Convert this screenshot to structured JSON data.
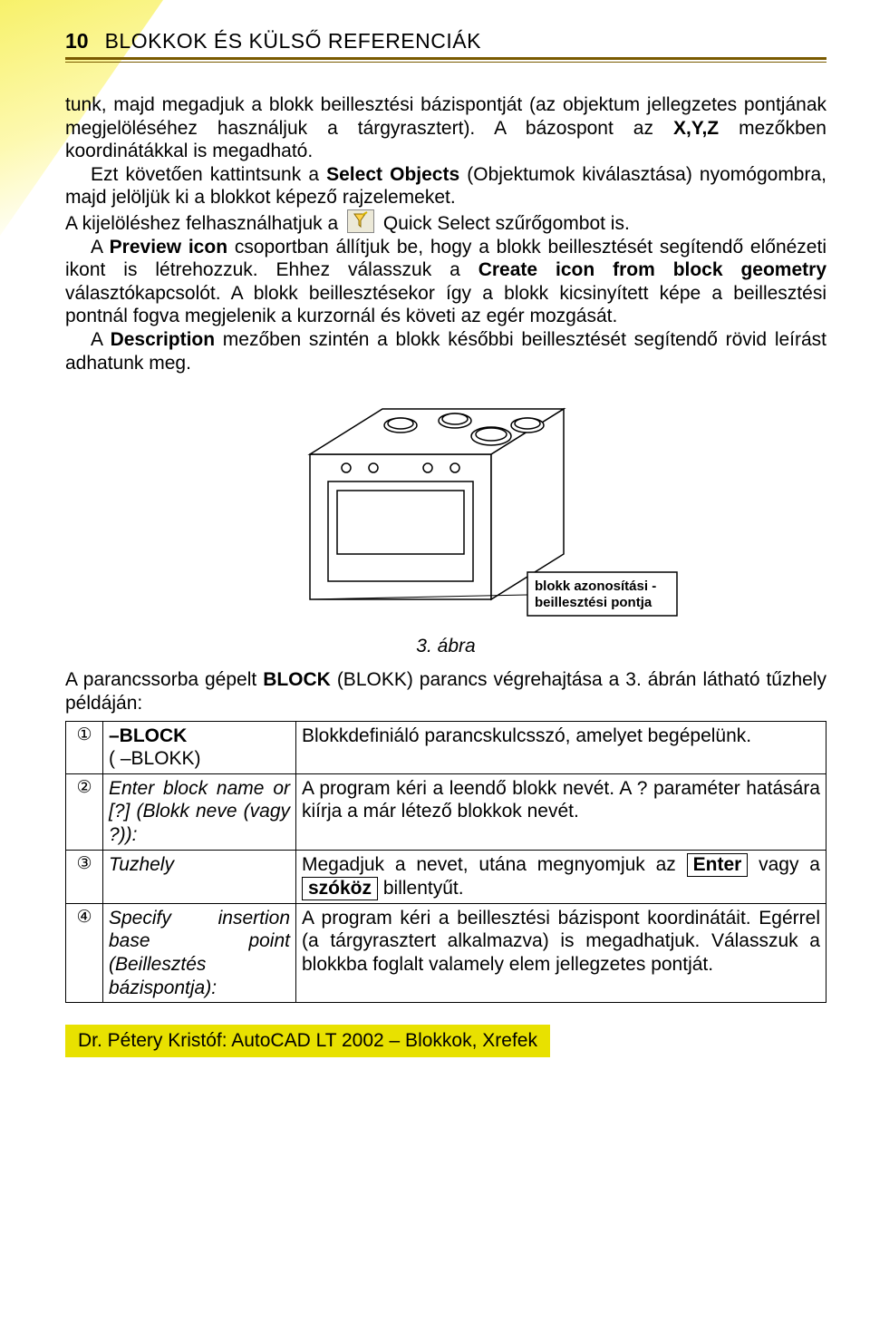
{
  "header": {
    "page_number": "10",
    "section_title": "BLOKKOK ÉS KÜLSŐ REFERENCIÁK"
  },
  "body": {
    "p1a": "tunk, majd megadjuk a blokk beillesztési bázispontját (az objektum jellegzetes pontjának megjelöléséhez használjuk a tárgyrasztert). A bázospont az ",
    "p1b_bold": "X,Y,Z",
    "p1c": " mezőkben koordinátákkal is megadható.",
    "p2a": "Ezt követően kattintsunk a ",
    "p2b_bold": "Select Objects",
    "p2c": " (Objektumok kiválasztása) nyomógombra, majd jelöljük ki a blokkot képező rajzelemeket.",
    "p3a": "A kijelöléshez felhasználhatjuk a ",
    "p3b": " Quick Select szűrőgombot is.",
    "p4a": "A ",
    "p4b_bold": "Preview icon",
    "p4c": " csoportban állítjuk be, hogy a blokk beillesztését segítendő előnézeti ikont is létrehozzuk. Ehhez válasszuk a ",
    "p4d_bold": "Create icon from block geometry",
    "p4e": " választókapcsolót. A blokk beillesztésekor így a blokk kicsinyített képe a beillesztési pontnál fogva megjelenik a kurzornál és követi az egér mozgását.",
    "p5a": "A ",
    "p5b_bold": "Description",
    "p5c": " mezőben szintén a blokk későbbi beillesztését segítendő rövid leírást adhatunk meg."
  },
  "figure": {
    "callout_line1": "blokk azonosítási -",
    "callout_line2": "beillesztési pontja",
    "caption": "3. ábra"
  },
  "after_fig": {
    "p1a": "A parancssorba gépelt ",
    "p1b_bold": "BLOCK",
    "p1c": " (BLOKK) parancs végrehajtása a 3. ábrán látható tűzhely példáján:"
  },
  "table": {
    "r1": {
      "num": "①",
      "c1a": "–BLOCK",
      "c1b": "( –BLOKK)",
      "c2": "Blokkdefiniáló parancskulcsszó, amelyet begépelünk."
    },
    "r2": {
      "num": "②",
      "c1": "Enter block name or [?] (Blokk neve (vagy ?)):",
      "c2": "A program kéri a leendő blokk nevét. A ? paraméter hatására kiírja a már létező blokkok nevét."
    },
    "r3": {
      "num": "③",
      "c1": "Tuzhely",
      "c2a": "Megadjuk a nevet, utána megnyomjuk az ",
      "key1": "Enter",
      "mid": " vagy a ",
      "key2": "szóköz",
      "c2b": " billentyűt."
    },
    "r4": {
      "num": "④",
      "c1": "Specify insertion base point (Beillesztés bázispontja):",
      "c2": "A program kéri a beillesztési bázispont koordinátáit. Egérrel (a tárgyrasztert alkalmazva) is megadhatjuk. Válasszuk a blokkba foglalt valamely elem jellegzetes pontját."
    }
  },
  "footer": "Dr. Pétery Kristóf: AutoCAD LT 2002 – Blokkok, Xrefek"
}
